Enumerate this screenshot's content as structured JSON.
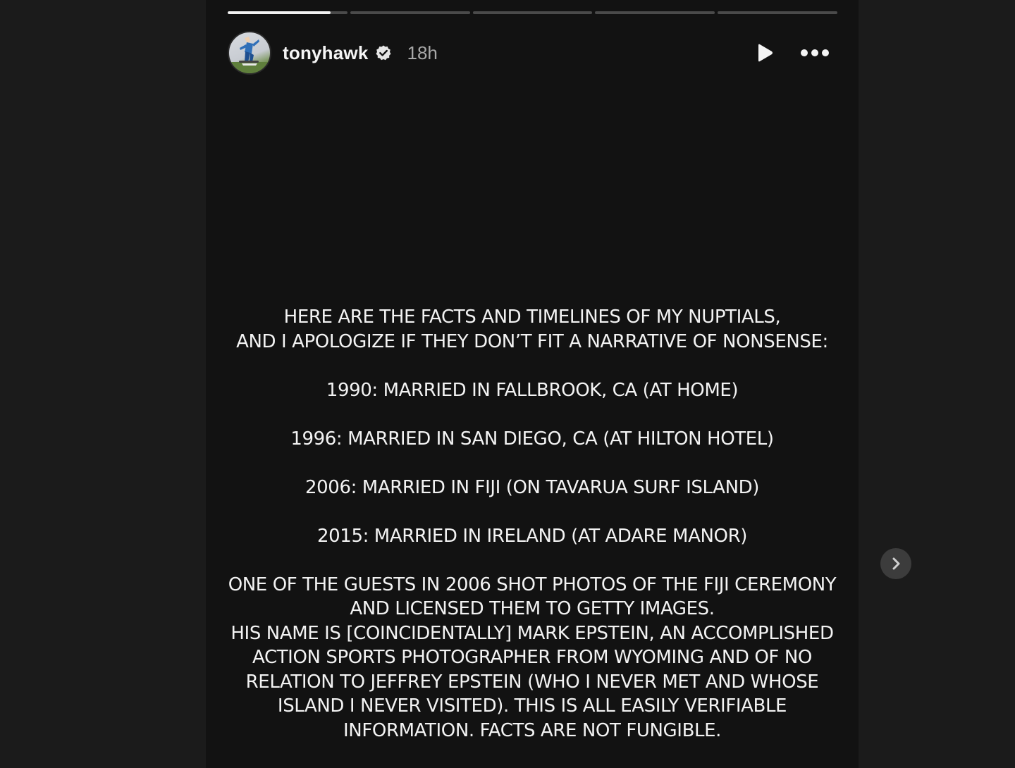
{
  "story": {
    "progress": {
      "segments": 5,
      "current_index": 0,
      "current_fraction": 0.86
    },
    "header": {
      "username": "tonyhawk",
      "verified": true,
      "timestamp": "18h",
      "play_icon": "play-icon",
      "more_icon": "more-options-icon"
    },
    "text": {
      "intro_1": "HERE ARE THE FACTS AND TIMELINES OF MY NUPTIALS,",
      "intro_2": "AND I APOLOGIZE IF THEY DON’T FIT A NARRATIVE OF NONSENSE:",
      "entry_1990": "1990: MARRIED IN FALLBROOK, CA (AT HOME)",
      "entry_1996": "1996: MARRIED IN SAN DIEGO, CA (AT HILTON HOTEL)",
      "entry_2006": "2006: MARRIED IN FIJI (ON TAVARUA SURF ISLAND)",
      "entry_2015": "2015: MARRIED IN IRELAND (AT ADARE MANOR)",
      "closing_1": "ONE OF THE GUESTS IN 2006 SHOT PHOTOS OF THE FIJI CEREMONY",
      "closing_2": "AND LICENSED THEM TO GETTY IMAGES.",
      "closing_3": "HIS NAME IS [COINCIDENTALLY] MARK EPSTEIN, AN ACCOMPLISHED",
      "closing_4": "ACTION SPORTS PHOTOGRAPHER FROM WYOMING AND OF NO",
      "closing_5": "RELATION TO JEFFREY EPSTEIN (WHO I NEVER MET AND WHOSE",
      "closing_6": "ISLAND I NEVER VISITED). THIS IS ALL EASILY VERIFIABLE",
      "closing_7": "INFORMATION. FACTS ARE NOT FUNGIBLE."
    },
    "next_icon": "chevron-right-icon"
  },
  "colors": {
    "page_bg": "#1b1b1b",
    "story_bg": "#121212",
    "text": "#f3f3f3",
    "muted": "#a8a8a8",
    "progress_track": "#4a4a4a",
    "progress_fill": "#f2f2f2"
  }
}
